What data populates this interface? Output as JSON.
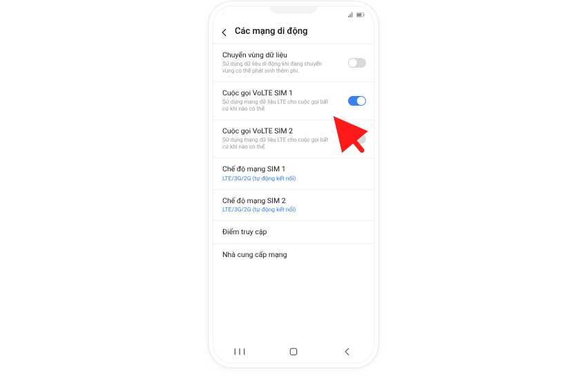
{
  "header": {
    "title": "Các mạng di động"
  },
  "items": [
    {
      "title": "Chuyển vùng dữ liệu",
      "desc": "Sử dụng dữ liệu di động khi đang chuyển vùng có thể phát sinh thêm phí.",
      "toggle": "off"
    },
    {
      "title": "Cuộc gọi VoLTE SIM 1",
      "desc": "Sử dụng mạng dữ liệu LTE cho cuộc gọi bất cứ khi nào có thể.",
      "toggle": "on"
    },
    {
      "title": "Cuộc gọi VoLTE SIM 2",
      "desc": "Sử dụng mạng dữ liệu LTE cho cuộc gọi bất cứ khi nào có thể.",
      "toggle": "off"
    },
    {
      "title": "Chế độ mạng SIM 1",
      "value": "LTE/3G/2G (tự động kết nối)"
    },
    {
      "title": "Chế độ mạng SIM 2",
      "value": "LTE/3G/2G (tự động kết nối)"
    },
    {
      "title": "Điểm truy cập"
    },
    {
      "title": "Nhà cung cấp mạng"
    }
  ],
  "annotation": {
    "color": "#ff1a1a",
    "target_item_index": 1
  }
}
